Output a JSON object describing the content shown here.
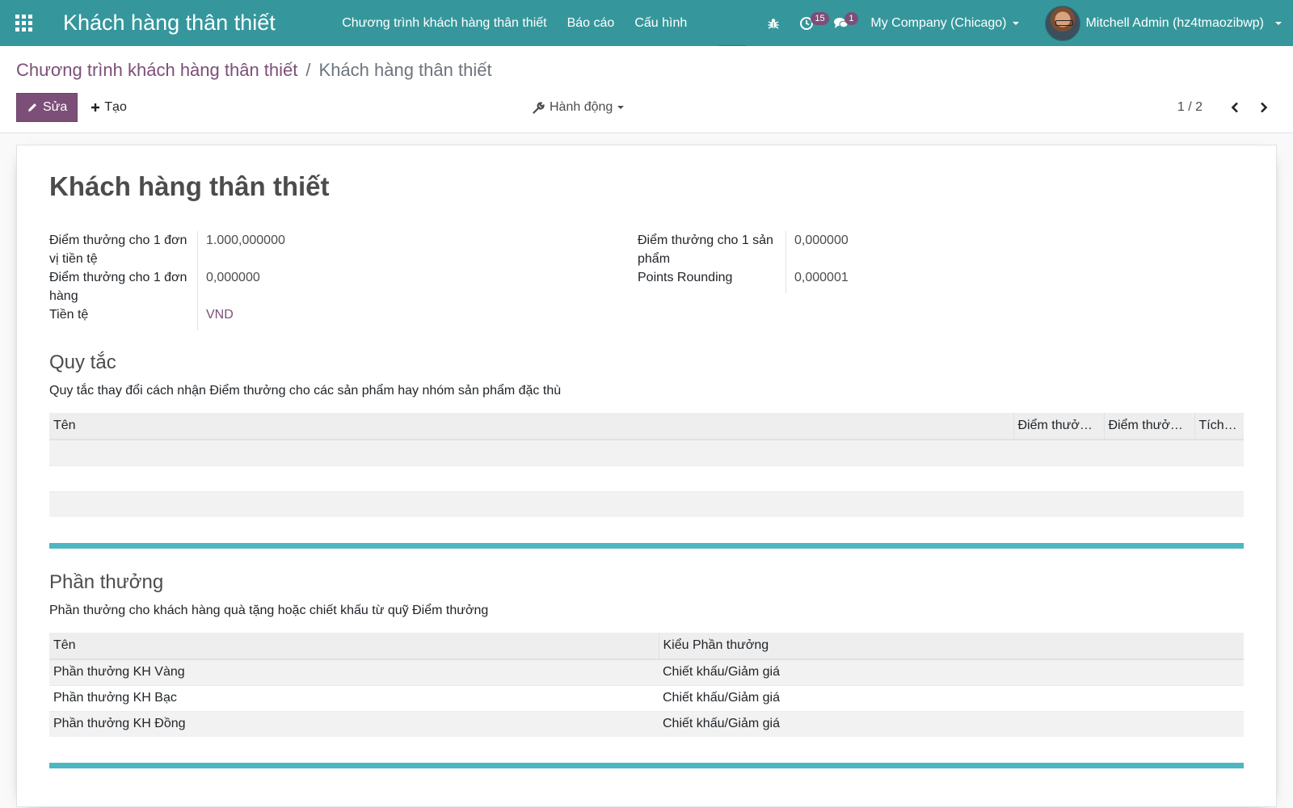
{
  "navbar": {
    "app_title": "Khách hàng thân thiết",
    "menu": [
      "Chương trình khách hàng thân thiết",
      "Báo cáo",
      "Cấu hình"
    ],
    "activity_count": "15",
    "message_count": "1",
    "company": "My Company (Chicago)",
    "user": "Mitchell Admin (hz4tmaozibwp)",
    "icons": [
      "apps-grid-icon",
      "bug-icon",
      "clock-icon",
      "chat-icon"
    ]
  },
  "breadcrumb": {
    "parent": "Chương trình khách hàng thân thiết",
    "separator": "/",
    "current": "Khách hàng thân thiết"
  },
  "toolbar": {
    "edit_label": "Sửa",
    "create_label": "Tạo",
    "action_label": "Hành động",
    "pager": "1 / 2"
  },
  "record": {
    "title": "Khách hàng thân thiết",
    "left_fields": [
      {
        "label": "Điểm thưởng cho 1 đơn vị tiền tệ",
        "value": "1.000,000000"
      },
      {
        "label": "Điểm thưởng cho 1 đơn hàng",
        "value": "0,000000"
      },
      {
        "label": "Tiền tệ",
        "value": "VND"
      }
    ],
    "right_fields": [
      {
        "label": "Điểm thưởng cho 1 sản phẩm",
        "value": "0,000000"
      },
      {
        "label": "Points Rounding",
        "value": "0,000001"
      }
    ]
  },
  "rules": {
    "title": "Quy tắc",
    "description": "Quy tắc thay đổi cách nhận Điểm thưởng cho các sản phẩm hay nhóm sản phẩm đặc thù",
    "columns": [
      "Tên",
      "Điểm thưởng...",
      "Điểm thưởng...",
      "Tích l..."
    ],
    "rows": []
  },
  "rewards": {
    "title": "Phần thưởng",
    "description": "Phần thưởng cho khách hàng quà tặng hoặc chiết khấu từ quỹ Điểm thưởng",
    "columns": [
      "Tên",
      "Kiểu Phần thưởng"
    ],
    "rows": [
      [
        "Phần thưởng KH Vàng",
        "Chiết khấu/Giảm giá"
      ],
      [
        "Phần thưởng KH Bạc",
        "Chiết khấu/Giảm giá"
      ],
      [
        "Phần thưởng KH Đồng",
        "Chiết khấu/Giảm giá"
      ]
    ]
  },
  "colors": {
    "navbar": "#35979c",
    "primary": "#7c4f78",
    "separator": "#4cb7c2"
  }
}
